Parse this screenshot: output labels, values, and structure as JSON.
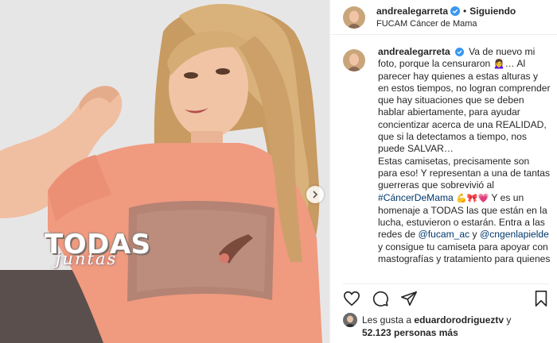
{
  "post": {
    "overlay_title": "TODAS",
    "overlay_script": "juntas",
    "next_button_icon": "chevron-right-icon"
  },
  "header": {
    "username": "andrealegarreta",
    "separator": "•",
    "follow_label": "Siguiendo",
    "location": "FUCAM Cáncer de Mama"
  },
  "caption": {
    "username": "andrealegarreta",
    "p1": "Va de nuevo mi foto, porque la censuraron 🙍‍♀️… Al parecer hay quienes a estas alturas y en estos tiempos, no logran comprender que hay situaciones que se deben hablar abiertamente, para ayudar concientizar acerca de una REALIDAD, que si la detectamos a tiempo, nos puede SALVAR…",
    "p2a": "Estas camisetas, precisamente son para eso! Y representan a una de tantas guerreras que sobrevivió al",
    "hashtag": "#CáncerDeMama",
    "emojis": "💪🎀💗",
    "p2b": "Y es un homenaje a TODAS las que están en la lucha, estuvieron o estarán. Entra a las redes de",
    "mention1": "@fucam_ac",
    "y": "y",
    "mention2": "@cngenlapielde",
    "p2c": "y consigue tu camiseta para apoyar con mastografías y tratamiento para quienes"
  },
  "likes": {
    "prefix": "Les gusta a",
    "user": "eduardorodrigueztv",
    "conj": "y",
    "count": "52.123 personas más"
  },
  "colors": {
    "link": "#00376b",
    "verified": "#3897f0",
    "shirt": "#f09a80"
  }
}
